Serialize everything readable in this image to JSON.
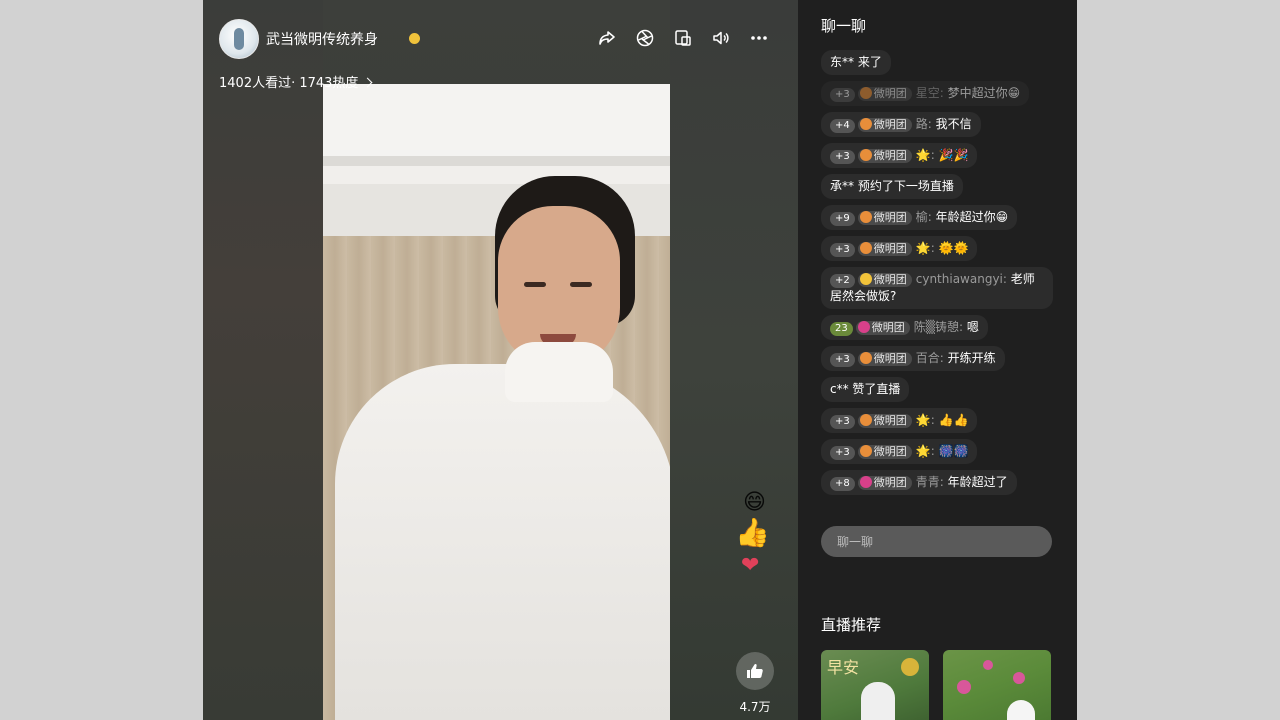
{
  "header": {
    "channel_name": "武当微明传统养身",
    "stats": "1402人看过· 1743热度"
  },
  "icons": {
    "share": "share-icon",
    "aperture": "aperture-icon",
    "picture_in_picture": "picture-in-picture-icon",
    "volume": "volume-icon",
    "more": "more-icon"
  },
  "video": {
    "like_count": "4.7万"
  },
  "chat": {
    "title": "聊一聊",
    "input_placeholder": "聊一聊",
    "messages": [
      {
        "type": "system",
        "text": "东** 来了"
      },
      {
        "type": "user",
        "level": "+3",
        "fan": "微明团",
        "user": "星空:",
        "text": "梦中超过你😁",
        "faded": true
      },
      {
        "type": "user",
        "level": "+4",
        "fan": "微明团",
        "user": "路:",
        "text": "我不信"
      },
      {
        "type": "user",
        "level": "+3",
        "fan": "微明团",
        "user": "🌟:",
        "text": "🎉🎉"
      },
      {
        "type": "system",
        "text": "承** 预约了下一场直播"
      },
      {
        "type": "user",
        "level": "+9",
        "fan": "微明团",
        "user": "榆:",
        "text": "年龄超过你😁"
      },
      {
        "type": "user",
        "level": "+3",
        "fan": "微明团",
        "user": "🌟:",
        "text": "🌞🌞"
      },
      {
        "type": "user",
        "level": "+2",
        "fan": "微明团",
        "user": "cynthiawangyi:",
        "text": "老师居然会做饭?"
      },
      {
        "type": "user",
        "level": "23",
        "fan": "微明团",
        "user": "陈▒铸憩:",
        "text": "嗯"
      },
      {
        "type": "user",
        "level": "+3",
        "fan": "微明团",
        "user": "百合:",
        "text": "开练开练"
      },
      {
        "type": "system",
        "text": "c** 赞了直播"
      },
      {
        "type": "user",
        "level": "+3",
        "fan": "微明团",
        "user": "🌟:",
        "text": "👍👍"
      },
      {
        "type": "user",
        "level": "+3",
        "fan": "微明团",
        "user": "🌟:",
        "text": "🎆🎆"
      },
      {
        "type": "user",
        "level": "+8",
        "fan": "微明团",
        "user": "青青:",
        "text": "年龄超过了"
      }
    ]
  },
  "recommend": {
    "title": "直播推荐",
    "card1_tag": "早安"
  },
  "colors": {
    "panel_bg": "#1f1f1f",
    "bubble_bg": "#2c2c2c",
    "page_bg": "#d2d2d2"
  }
}
